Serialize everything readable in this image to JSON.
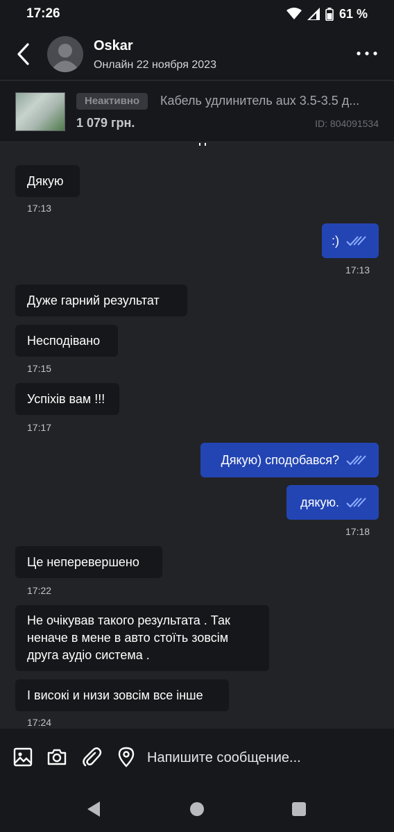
{
  "status_bar": {
    "time": "17:26",
    "battery": "61 %"
  },
  "header": {
    "name": "Oskar",
    "status": "Онлайн 22 ноября 2023"
  },
  "listing": {
    "badge": "Неактивно",
    "title": "Кабель удлинитель aux  3.5-3.5  д...",
    "price": "1 079 грн.",
    "id": "ID: 804091534"
  },
  "messages": [
    {
      "dir": "in",
      "text": "Дякую",
      "time": "17:13"
    },
    {
      "dir": "out",
      "text": ":)",
      "time": "17:13"
    },
    {
      "dir": "in",
      "text": "Дуже гарний результат",
      "time": ""
    },
    {
      "dir": "in",
      "text": "Несподівано",
      "time": "17:15"
    },
    {
      "dir": "in",
      "text": "Успіхів вам !!!",
      "time": "17:17"
    },
    {
      "dir": "out",
      "text": "Дякую) сподобався?",
      "time": ""
    },
    {
      "dir": "out",
      "text": "дякую.",
      "time": "17:18"
    },
    {
      "dir": "in",
      "text": "Це неперевершено",
      "time": "17:22"
    },
    {
      "dir": "in",
      "text": "Не очікував такого результата . Так\nненаче в мене в авто стоїть зовсім\nдруга аудіо система .",
      "time": ""
    },
    {
      "dir": "in",
      "text": "І високі и низи зовсім все інше",
      "time": "17:24"
    }
  ],
  "input": {
    "placeholder": "Напишите сообщение..."
  },
  "colors": {
    "outgoing": "#2345b3",
    "incoming": "#16171a",
    "background": "#222327",
    "check": "#8fb0ff"
  }
}
